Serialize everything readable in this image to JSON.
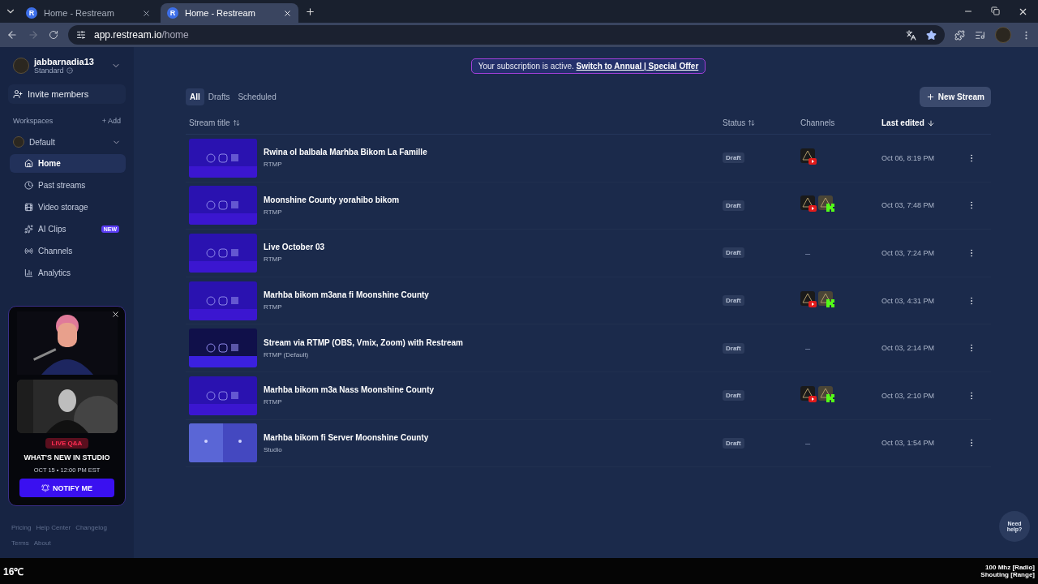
{
  "browser": {
    "tabs": [
      {
        "title": "Home - Restream",
        "favicon": "R",
        "selected": false
      },
      {
        "title": "Home - Restream",
        "favicon": "R",
        "selected": true
      }
    ],
    "url_host": "app.restream.io",
    "url_path": "/home"
  },
  "sidebar": {
    "account": {
      "name": "jabbarnadia13",
      "plan": "Standard"
    },
    "invite": "Invite members",
    "workspaces_label": "Workspaces",
    "add_label": "+ Add",
    "workspace": "Default",
    "items": [
      {
        "label": "Home",
        "kind": "home",
        "selected": true
      },
      {
        "label": "Past streams",
        "kind": "history",
        "selected": false
      },
      {
        "label": "Video storage",
        "kind": "storage",
        "selected": false
      },
      {
        "label": "AI Clips",
        "kind": "clips",
        "selected": false,
        "badge": "NEW"
      },
      {
        "label": "Channels",
        "kind": "channels",
        "selected": false
      },
      {
        "label": "Analytics",
        "kind": "analytics",
        "selected": false
      }
    ],
    "promo": {
      "tag": "LIVE Q&A",
      "title": "WHAT'S NEW IN STUDIO",
      "date": "OCT 15 • 12:00 PM EST",
      "button": "NOTIFY ME"
    },
    "footer_links": [
      "Pricing",
      "Help Center",
      "Changelog",
      "Terms",
      "About"
    ]
  },
  "banner": {
    "text": "Your subscription is active.",
    "link": "Switch to Annual | Special Offer"
  },
  "filters": [
    {
      "label": "All",
      "selected": true
    },
    {
      "label": "Drafts",
      "selected": false
    },
    {
      "label": "Scheduled",
      "selected": false
    }
  ],
  "new_stream_button": "New Stream",
  "table": {
    "columns": [
      {
        "label": "Stream title",
        "kind": "sortable",
        "active": false
      },
      {
        "label": "Status",
        "kind": "sortable",
        "active": false
      },
      {
        "label": "Channels",
        "kind": "plain",
        "active": false
      },
      {
        "label": "Last edited",
        "kind": "sorted",
        "active": true
      }
    ],
    "rows": [
      {
        "title": "Rwina ol balbala Marhba Bikom La Famille",
        "source": "RTMP",
        "kind": "rtmp",
        "status": "Draft",
        "channels": [
          {
            "kind": "youtube"
          }
        ],
        "edited": "Oct 06, 8:19 PM"
      },
      {
        "title": "Moonshine County yorahibo bikom",
        "source": "RTMP",
        "kind": "rtmp",
        "status": "Draft",
        "channels": [
          {
            "kind": "youtube"
          },
          {
            "kind": "kick"
          }
        ],
        "edited": "Oct 03, 7:48 PM"
      },
      {
        "title": "Live October 03",
        "source": "RTMP",
        "kind": "rtmp",
        "status": "Draft",
        "no_channels": "–",
        "edited": "Oct 03, 7:24 PM"
      },
      {
        "title": "Marhba bikom m3ana fi Moonshine County",
        "source": "RTMP",
        "kind": "rtmp",
        "status": "Draft",
        "channels": [
          {
            "kind": "youtube"
          },
          {
            "kind": "kick"
          }
        ],
        "edited": "Oct 03, 4:31 PM"
      },
      {
        "title": "Stream via RTMP (OBS, Vmix, Zoom) with Restream",
        "source": "RTMP (Default)",
        "kind": "rtmp_default",
        "status": "Draft",
        "no_channels": "–",
        "edited": "Oct 03, 2:14 PM"
      },
      {
        "title": "Marhba bikom m3a Nass Moonshine County",
        "source": "RTMP",
        "kind": "rtmp",
        "status": "Draft",
        "channels": [
          {
            "kind": "youtube"
          },
          {
            "kind": "kick"
          }
        ],
        "edited": "Oct 03, 2:10 PM"
      },
      {
        "title": "Marhba bikom fi Server Moonshine County",
        "source": "Studio",
        "kind": "studio",
        "status": "Draft",
        "no_channels": "–",
        "edited": "Oct 03, 1:54 PM"
      }
    ]
  },
  "help_button": "Need help?",
  "overlay": {
    "temperature": "16℃",
    "lines": [
      "100 Mhz [Radio]",
      "Shouting [Range]"
    ]
  }
}
